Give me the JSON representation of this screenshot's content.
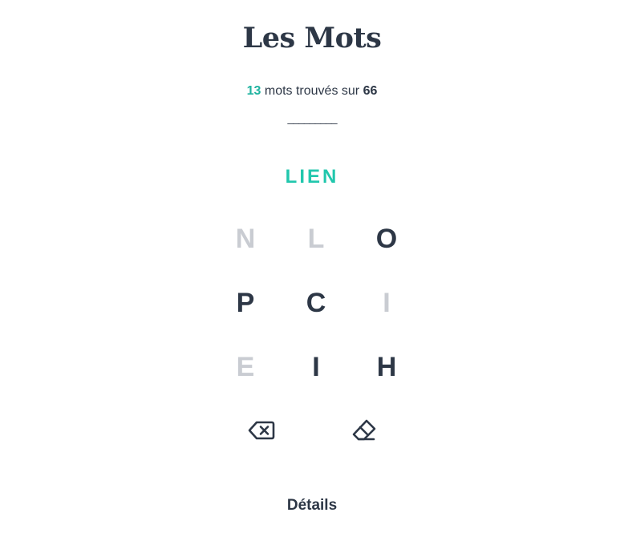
{
  "app": {
    "title": "Les Mots"
  },
  "score": {
    "found": "13",
    "middle_text": " mots trouvés sur ",
    "total": "66"
  },
  "underline": "_________",
  "current_word": "LIEN",
  "grid": [
    {
      "letter": "N",
      "used": true
    },
    {
      "letter": "L",
      "used": true
    },
    {
      "letter": "O",
      "used": false
    },
    {
      "letter": "P",
      "used": false
    },
    {
      "letter": "C",
      "used": false
    },
    {
      "letter": "I",
      "used": true
    },
    {
      "letter": "E",
      "used": true
    },
    {
      "letter": "I",
      "used": false
    },
    {
      "letter": "H",
      "used": false
    }
  ],
  "controls": {
    "backspace_icon": "backspace-icon",
    "eraser_icon": "eraser-icon"
  },
  "details_label": "Détails",
  "colors": {
    "accent": "#1fb3a0",
    "text": "#2d3746",
    "used_letter": "#c9ccd2"
  }
}
